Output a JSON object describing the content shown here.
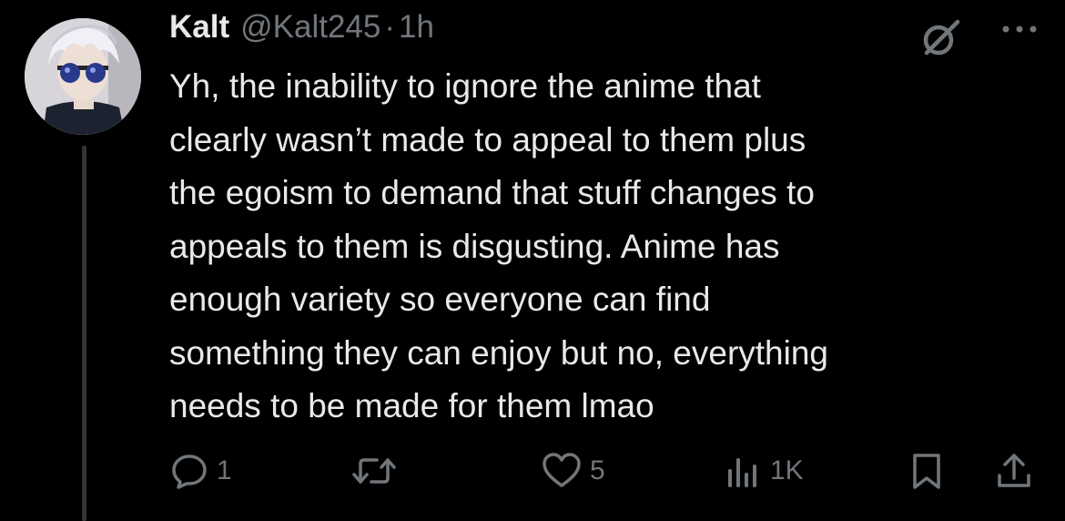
{
  "tweet": {
    "author": {
      "display_name": "Kalt",
      "handle": "@Kalt245",
      "separator": "·",
      "time": "1h"
    },
    "text": "Yh, the inability to ignore the anime that\nclearly wasn’t made to appeal to them plus\nthe egoism to demand that stuff changes to\nappeals to them is disgusting. Anime has\nenough variety so everyone can find\nsomething they can enjoy but no, everything\nneeds to be made for them lmao",
    "icons": {
      "avatar": "avatar-anime-character",
      "grok": "grok-icon",
      "more": "more-icon",
      "reply": "reply-icon",
      "retweet": "retweet-icon",
      "like": "heart-icon",
      "views": "views-icon",
      "bookmark": "bookmark-icon",
      "share": "share-icon"
    },
    "stats": {
      "replies": "1",
      "retweets": "",
      "likes": "5",
      "views": "1K"
    },
    "colors": {
      "background": "#000000",
      "text": "#e7e9ea",
      "secondary": "#71767b",
      "thread_line": "#333639"
    }
  }
}
